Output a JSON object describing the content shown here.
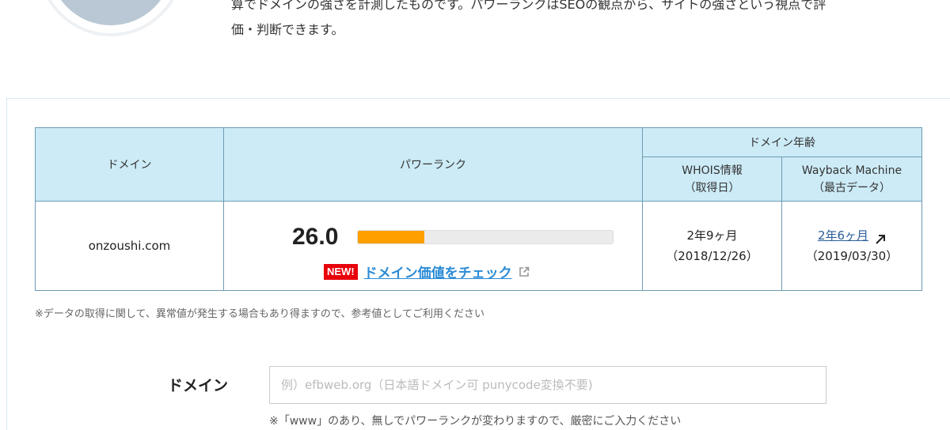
{
  "intro": {
    "line1": "算でドメインの強さを計測したものです。パワーランクはSEOの観点から、サイトの強さという視点で評",
    "line2": "価・判断できます。"
  },
  "table": {
    "headers": {
      "domain": "ドメイン",
      "power_rank": "パワーランク",
      "domain_age": "ドメイン年齢",
      "whois_line1": "WHOIS情報",
      "whois_line2": "（取得日）",
      "wayback_line1": "Wayback Machine",
      "wayback_line2": "（最古データ）"
    },
    "row": {
      "domain": "onzoushi.com",
      "score": "26.0",
      "score_fraction": 0.26,
      "new_badge": "NEW!",
      "check_link": "ドメイン価値をチェック",
      "whois_age": "2年9ヶ月",
      "whois_date": "（2018/12/26）",
      "wayback_age": "2年6ヶ月",
      "wayback_date": "（2019/03/30）"
    }
  },
  "note": "※データの取得に関して、異常値が発生する場合もあり得ますので、参考値としてご利用ください",
  "form": {
    "label": "ドメイン",
    "placeholder": "例）efbweb.org（日本語ドメイン可 punycode変換不要)",
    "note": "※「www」のあり、無しでパワーランクが変わりますので、厳密にご入力ください"
  },
  "colors": {
    "header_bg": "#ccebf6",
    "bar_fill": "#ff9f00",
    "badge_bg": "#e8000b",
    "link": "#2a8bd6"
  }
}
